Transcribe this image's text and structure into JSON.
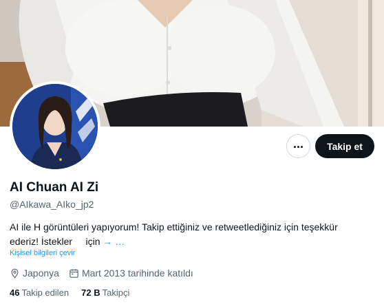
{
  "profile": {
    "name": "AI Chuan AI Zi",
    "handle": "@AIkawa_AIko_jp2",
    "bio_text": "AI ile H görüntüleri yapıyorum! Takip ettiğiniz ve retweetlediğiniz için teşekkür ederiz! İstekler     için ",
    "bio_more": "→ …",
    "translate_link": "Kişisel bilgileri çevir",
    "location": "Japonya",
    "joined": "Mart 2013 tarihinde katıldı",
    "following_count": "46",
    "following_label": "Takip edilen",
    "followers_count": "72 B",
    "followers_label": "Takipçi"
  },
  "actions": {
    "more_label": "...",
    "follow_label": "Takip et"
  },
  "colors": {
    "accent": "#1d9bf0",
    "text_primary": "#0f1419",
    "text_secondary": "#536471",
    "follow_button_bg": "#0f1419"
  },
  "icons": {
    "location": "location-pin-icon",
    "calendar": "calendar-icon",
    "more": "more-dots-icon"
  }
}
